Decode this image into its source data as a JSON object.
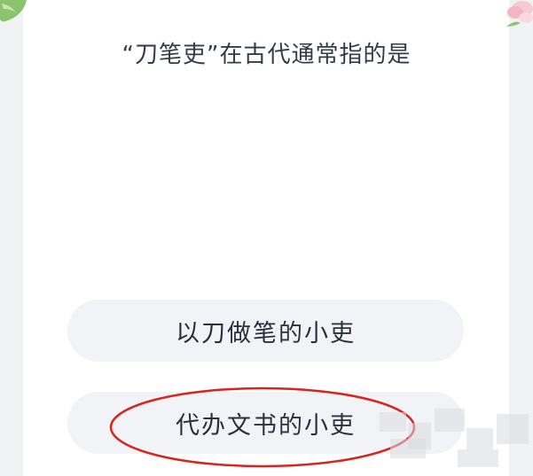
{
  "quiz": {
    "question": "“刀笔吏”在古代通常指的是",
    "options": [
      {
        "label": "以刀做笔的小吏"
      },
      {
        "label": "代办文书的小吏"
      }
    ]
  },
  "decorations": {
    "left_icon": "leaf-icon",
    "right_icon": "flower-icon"
  },
  "annotation": {
    "highlight_color": "#d9231d",
    "highlighted_option_index": 1
  },
  "colors": {
    "page_background": "#f1f2f4",
    "card_background": "#ffffff",
    "option_background": "#f1f3f6",
    "text": "#333a48"
  }
}
